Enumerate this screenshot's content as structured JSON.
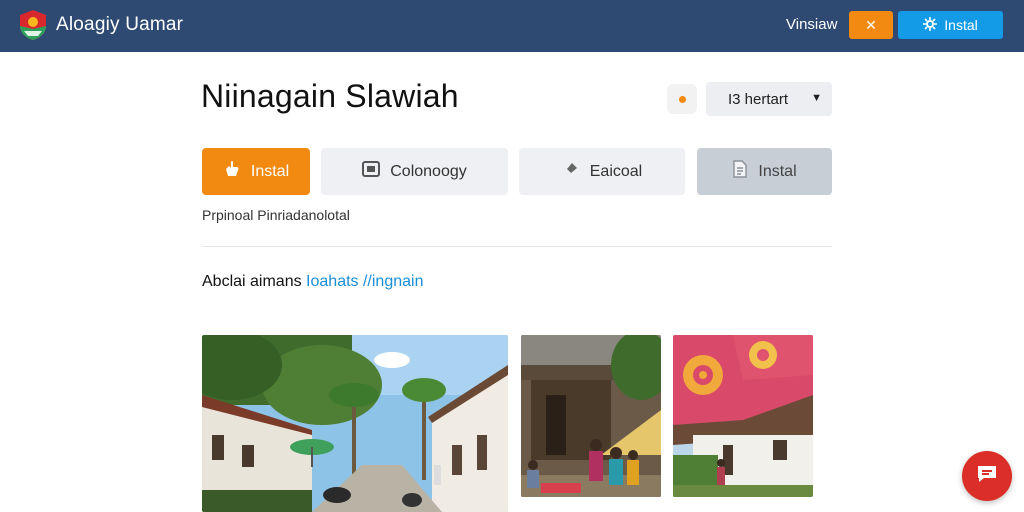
{
  "topbar": {
    "brand_name": "Aloagiy Uamar",
    "link_label": "Vinsiaw",
    "orange_btn_label": "✕",
    "blue_btn_label": "Instal",
    "colors": {
      "bar": "#2e4a72",
      "orange": "#f28a12",
      "blue": "#139be8"
    }
  },
  "header": {
    "title": "Niinagain Slawiah",
    "select_value": "I3 hertart"
  },
  "actions": [
    {
      "label": "Instal",
      "icon": "hand-icon"
    },
    {
      "label": "Colonoogy",
      "icon": "window-icon"
    },
    {
      "label": "Eaicoal",
      "icon": "pin-icon"
    },
    {
      "label": "Instal",
      "icon": "document-icon"
    }
  ],
  "subtext": "Prpinoal Pinriadanolotal",
  "section": {
    "heading_plain": "Abclai aimans ",
    "heading_accent": "Ioahats //ingnain"
  },
  "photos": [
    {
      "name": "village-street-photo"
    },
    {
      "name": "market-stall-photo"
    },
    {
      "name": "batik-cloth-photo"
    }
  ],
  "fab": {
    "icon": "chat-icon",
    "color": "#dc2e28"
  }
}
